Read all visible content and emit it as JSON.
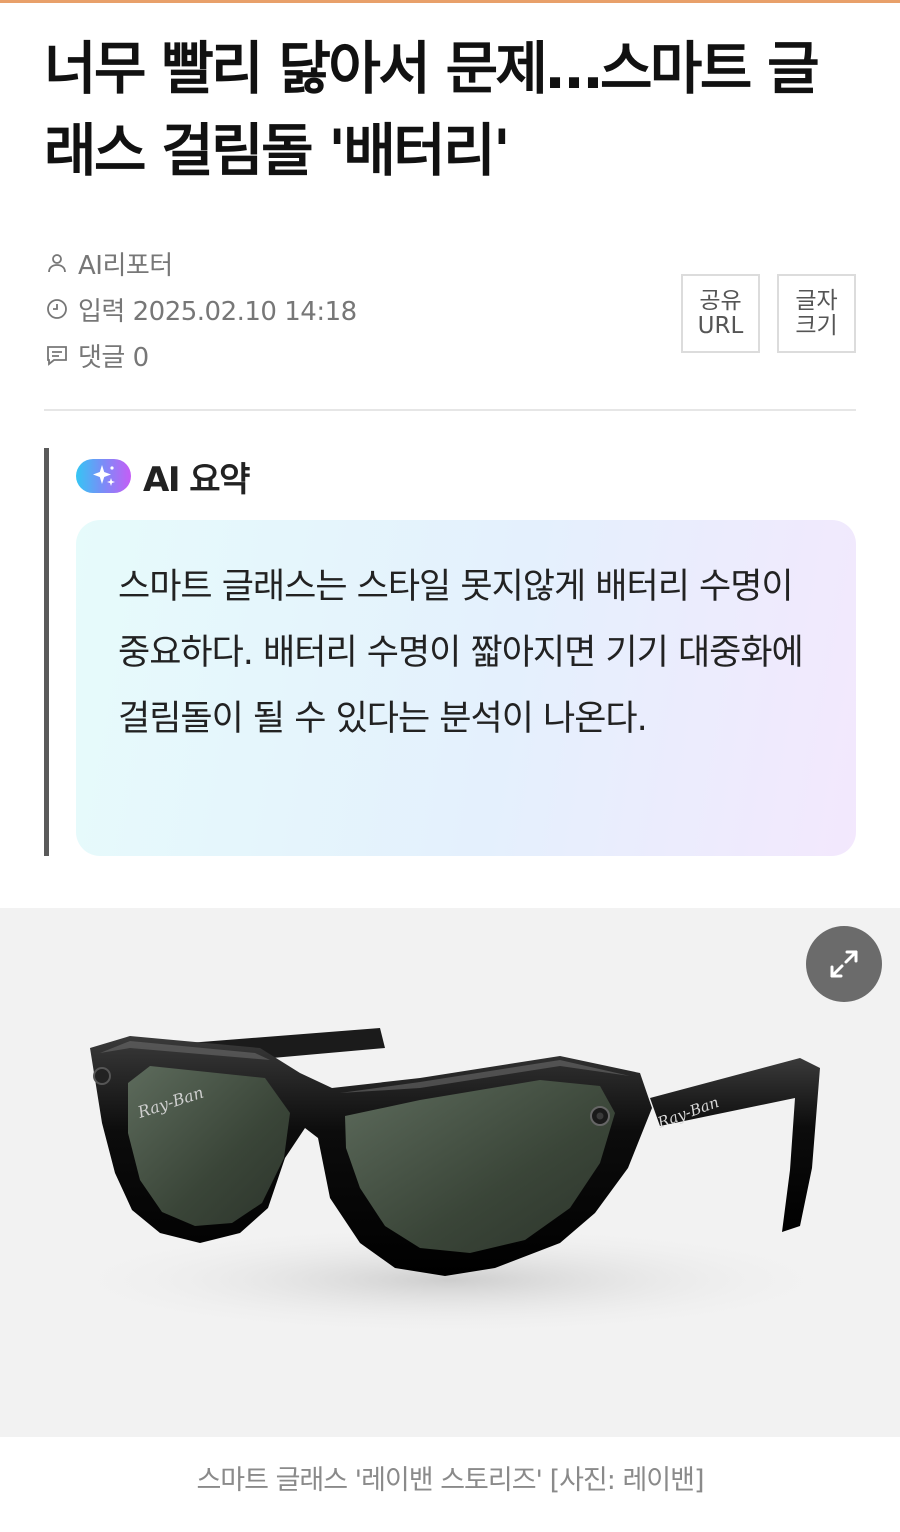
{
  "article": {
    "headline": "너무 빨리 닳아서 문제…스마트 글래스 걸림돌 '배터리'",
    "author": "AI리포터",
    "date_label": "입력 2025.02.10 14:18",
    "comments_label": "댓글 0"
  },
  "tools": {
    "share_line1": "공유",
    "share_line2": "URL",
    "font_line1": "글자",
    "font_line2": "크기"
  },
  "ai_summary": {
    "title": "AI 요약",
    "text": "스마트 글래스는 스타일 못지않게 배터리 수명이 중요하다. 배터리 수명이 짧아지면 기기 대중화에 걸림돌이 될 수 있다는 분석이 나온다."
  },
  "photo": {
    "brand_mark": "Ray-Ban",
    "caption": "스마트 글래스 '레이밴 스토리즈' [사진: 레이밴]"
  },
  "icons": {
    "author": "person-icon",
    "date": "clock-icon",
    "comments": "comment-icon",
    "ai": "sparkle-icon",
    "expand": "expand-icon"
  },
  "colors": {
    "accent_line": "#e8a06a",
    "ai_gradient_start": "#35c6f4",
    "ai_gradient_end": "#c55df6"
  }
}
